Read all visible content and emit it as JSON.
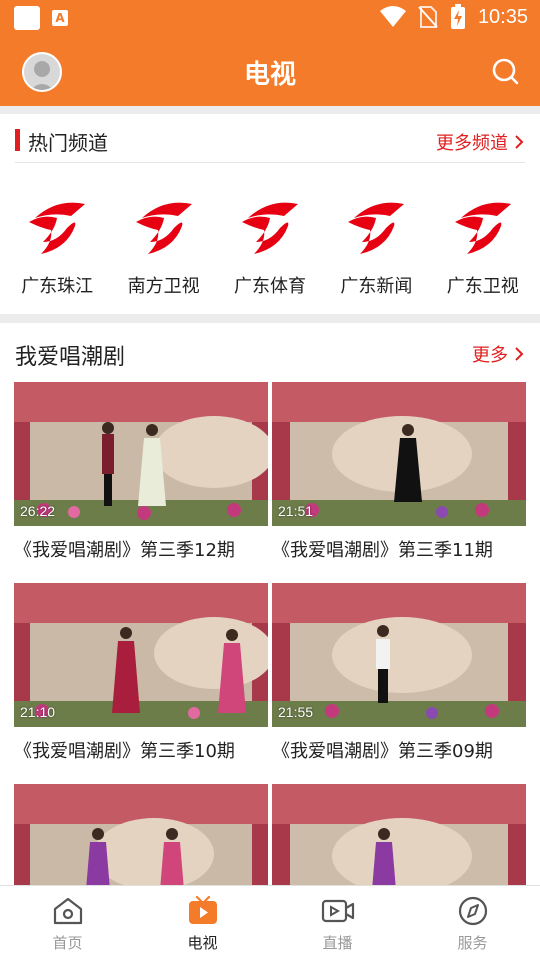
{
  "status_bar": {
    "time": "10:35"
  },
  "header": {
    "title": "电视"
  },
  "hot_channels": {
    "title": "热门频道",
    "more_label": "更多频道",
    "channels": [
      {
        "name": "广东珠江"
      },
      {
        "name": "南方卫视"
      },
      {
        "name": "广东体育"
      },
      {
        "name": "广东新闻"
      },
      {
        "name": "广东卫视"
      }
    ]
  },
  "opera_section": {
    "title": "我爱唱潮剧",
    "more_label": "更多",
    "videos": [
      {
        "title": "《我爱唱潮剧》第三季12期",
        "duration": "26:22"
      },
      {
        "title": "《我爱唱潮剧》第三季11期",
        "duration": "21:51"
      },
      {
        "title": "《我爱唱潮剧》第三季10期",
        "duration": "21:10"
      },
      {
        "title": "《我爱唱潮剧》第三季09期",
        "duration": "21:55"
      },
      {
        "title": "",
        "duration": ""
      },
      {
        "title": "",
        "duration": ""
      }
    ]
  },
  "bottom_nav": [
    {
      "label": "首页",
      "icon": "home-icon",
      "active": false
    },
    {
      "label": "电视",
      "icon": "tv-icon",
      "active": true
    },
    {
      "label": "直播",
      "icon": "live-camera-icon",
      "active": false
    },
    {
      "label": "服务",
      "icon": "compass-icon",
      "active": false
    }
  ],
  "colors": {
    "brand": "#f47b2a",
    "accent_red": "#e02020",
    "inactive": "#999999"
  }
}
